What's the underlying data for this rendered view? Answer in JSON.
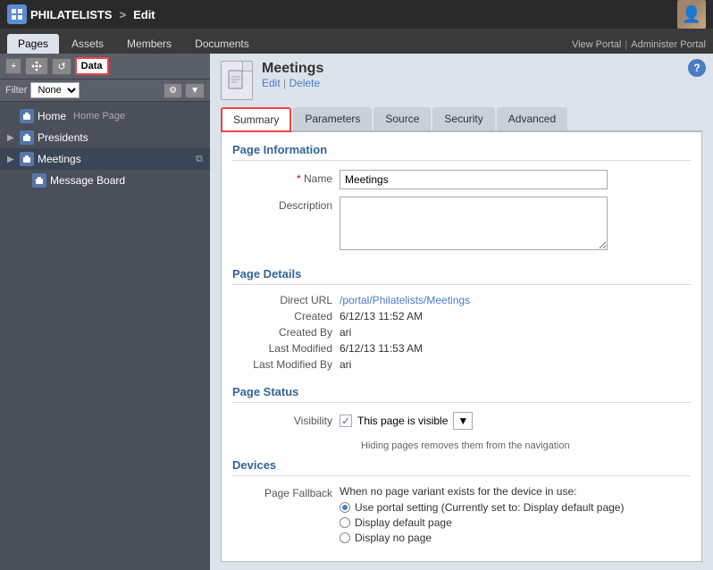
{
  "topbar": {
    "logo_text": "PHILATELISTS",
    "breadcrumb_separator": ">",
    "breadcrumb_page": "Edit"
  },
  "navtabs": {
    "tabs": [
      {
        "id": "pages",
        "label": "Pages",
        "active": true
      },
      {
        "id": "assets",
        "label": "Assets"
      },
      {
        "id": "members",
        "label": "Members"
      },
      {
        "id": "documents",
        "label": "Documents"
      }
    ],
    "top_links": [
      {
        "label": "View Portal"
      },
      {
        "sep": "|"
      },
      {
        "label": "Administer Portal"
      }
    ]
  },
  "sidebar": {
    "toolbar": {
      "add_btn": "+",
      "move_btn": "⊕",
      "refresh_btn": "↺",
      "data_btn": "Data"
    },
    "filter": {
      "label": "Filter",
      "value": "None"
    },
    "tree": [
      {
        "id": "home",
        "label": "Home",
        "sublabel": "Home Page",
        "level": 0,
        "active": false
      },
      {
        "id": "presidents",
        "label": "Presidents",
        "level": 0,
        "active": false
      },
      {
        "id": "meetings",
        "label": "Meetings",
        "level": 0,
        "active": true
      },
      {
        "id": "message-board",
        "label": "Message Board",
        "level": 1,
        "active": false
      }
    ]
  },
  "content": {
    "page_title": "Meetings",
    "edit_link": "Edit",
    "delete_link": "Delete",
    "help_label": "?",
    "tabs": [
      {
        "id": "summary",
        "label": "Summary",
        "active": true
      },
      {
        "id": "parameters",
        "label": "Parameters"
      },
      {
        "id": "source",
        "label": "Source"
      },
      {
        "id": "security",
        "label": "Security"
      },
      {
        "id": "advanced",
        "label": "Advanced"
      }
    ]
  },
  "form": {
    "page_information": {
      "section_title": "Page Information",
      "name_label": "Name",
      "name_required": "* ",
      "name_value": "Meetings",
      "description_label": "Description",
      "description_value": ""
    },
    "page_details": {
      "section_title": "Page Details",
      "direct_url_label": "Direct URL",
      "direct_url_value": "/portal/Philatelists/Meetings",
      "created_label": "Created",
      "created_value": "6/12/13 11:52 AM",
      "created_by_label": "Created By",
      "created_by_value": "ari",
      "last_modified_label": "Last Modified",
      "last_modified_value": "6/12/13 11:53 AM",
      "last_modified_by_label": "Last Modified By",
      "last_modified_by_value": "ari"
    },
    "page_status": {
      "section_title": "Page Status",
      "visibility_label": "Visibility",
      "visibility_text": "This page is visible",
      "hint_text": "Hiding pages removes them from the navigation"
    },
    "devices": {
      "section_title": "Devices",
      "page_fallback_label": "Page Fallback",
      "page_fallback_desc": "When no page variant exists for the device in use:",
      "options": [
        {
          "id": "portal-setting",
          "label": "Use portal setting (Currently set to: Display default page)",
          "selected": true
        },
        {
          "id": "display-default",
          "label": "Display default page",
          "selected": false
        },
        {
          "id": "display-none",
          "label": "Display no page",
          "selected": false
        }
      ]
    }
  }
}
